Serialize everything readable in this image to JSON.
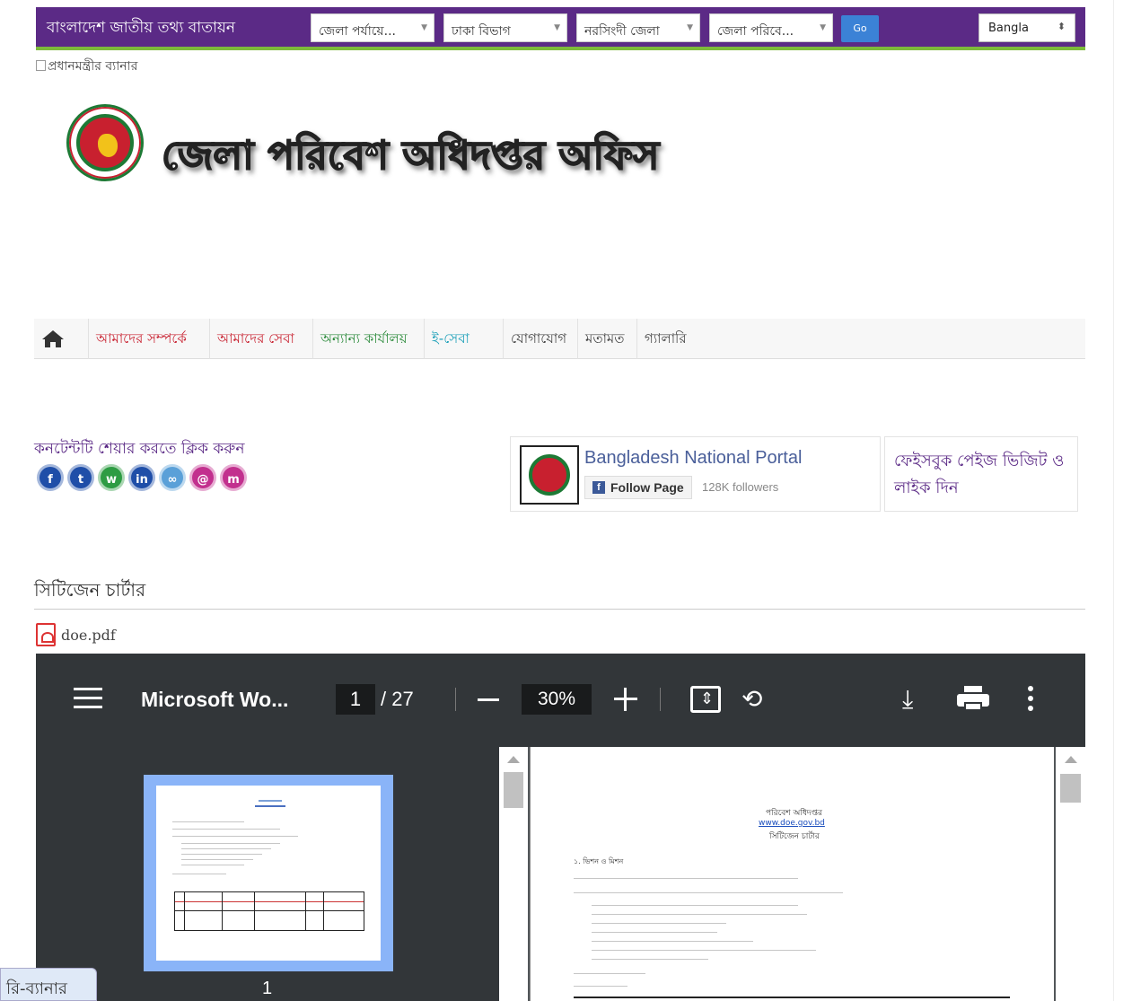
{
  "topbar": {
    "site_title": "বাংলাদেশ জাতীয় তথ্য বাতায়ন",
    "selects": [
      {
        "label": "জেলা পর্যায়ে..."
      },
      {
        "label": "ঢাকা বিভাগ"
      },
      {
        "label": "নরসিংদী জেলা"
      },
      {
        "label": "জেলা পরিবে..."
      }
    ],
    "go_label": "Go",
    "language": "Bangla"
  },
  "banner_alt": "প্রধানমন্ত্রীর ব্যানার",
  "header": {
    "office_title": "জেলা পরিবেশ অধিদপ্তর অফিস"
  },
  "nav": {
    "items": [
      {
        "label": "আমাদের সম্পর্কে"
      },
      {
        "label": "আমাদের সেবা"
      },
      {
        "label": "অন্যান্য কার্যালয়"
      },
      {
        "label": "ই-সেবা"
      },
      {
        "label": "যোগাযোগ"
      },
      {
        "label": "মতামত"
      },
      {
        "label": "গ্যালারি"
      }
    ]
  },
  "share": {
    "label": "কনটেন্টটি শেয়ার করতে ক্লিক করুন",
    "icons": [
      {
        "name": "facebook-icon",
        "glyph": "f",
        "color": "#1f4ea8"
      },
      {
        "name": "twitter-icon",
        "glyph": "t",
        "color": "#1f4ea8"
      },
      {
        "name": "whatsapp-icon",
        "glyph": "w",
        "color": "#2e9c43"
      },
      {
        "name": "linkedin-icon",
        "glyph": "in",
        "color": "#1f4ea8"
      },
      {
        "name": "link-icon",
        "glyph": "∞",
        "color": "#5aa0d8"
      },
      {
        "name": "email-icon",
        "glyph": "@",
        "color": "#c2308e"
      },
      {
        "name": "messenger-icon",
        "glyph": "m",
        "color": "#c2308e"
      }
    ]
  },
  "facebook_widget": {
    "page_name": "Bangladesh National Portal",
    "follow_label": "Follow Page",
    "followers": "128K followers",
    "cta": "ফেইসবুক পেইজ ভিজিট ও লাইক দিন"
  },
  "charter": {
    "title": "সিটিজেন চার্টার",
    "file_name": "doe.pdf"
  },
  "pdf_viewer": {
    "doc_title": "Microsoft Wo...",
    "current_page": "1",
    "total_pages": "/ 27",
    "zoom": "30%",
    "thumb_label": "1",
    "page_heading": "পরিবেশ অধিদপ্তর",
    "page_link": "www.doe.gov.bd",
    "page_subheading": "সিটিজেন চার্টার",
    "section_1": "১. ভিশন ও মিশন"
  },
  "side_tab": "রি-ব্যানার"
}
